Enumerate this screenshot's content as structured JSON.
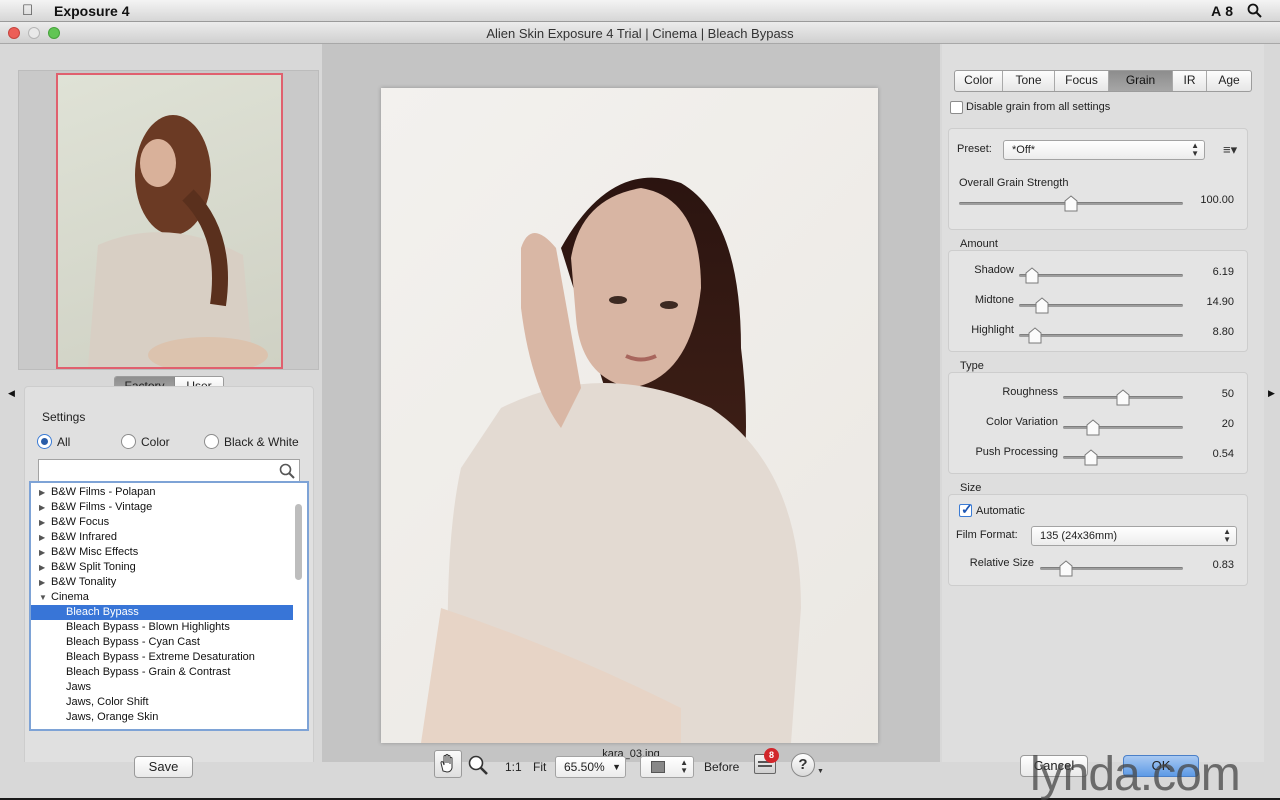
{
  "menubar": {
    "app_name": "Exposure 4",
    "status_num": "8"
  },
  "window": {
    "title": "Alien Skin Exposure 4 Trial | Cinema | Bleach Bypass"
  },
  "left": {
    "factory_tab": "Factory",
    "user_tab": "User",
    "settings_label": "Settings",
    "filters": {
      "all": "All",
      "color": "Color",
      "bw": "Black & White"
    },
    "search_placeholder": "",
    "presets": [
      {
        "label": "B&W Films - Polapan",
        "type": "folder"
      },
      {
        "label": "B&W Films - Vintage",
        "type": "folder"
      },
      {
        "label": "B&W Focus",
        "type": "folder"
      },
      {
        "label": "B&W Infrared",
        "type": "folder"
      },
      {
        "label": "B&W Misc Effects",
        "type": "folder"
      },
      {
        "label": "B&W Split Toning",
        "type": "folder"
      },
      {
        "label": "B&W Tonality",
        "type": "folder"
      },
      {
        "label": "Cinema",
        "type": "open"
      },
      {
        "label": "Bleach Bypass",
        "type": "selected"
      },
      {
        "label": "Bleach Bypass - Blown Highlights",
        "type": "child"
      },
      {
        "label": "Bleach Bypass - Cyan Cast",
        "type": "child"
      },
      {
        "label": "Bleach Bypass - Extreme Desaturation",
        "type": "child"
      },
      {
        "label": "Bleach Bypass - Grain & Contrast",
        "type": "child"
      },
      {
        "label": "Jaws",
        "type": "child"
      },
      {
        "label": "Jaws, Color Shift",
        "type": "child"
      },
      {
        "label": "Jaws, Orange Skin",
        "type": "child"
      }
    ],
    "save_label": "Save"
  },
  "center": {
    "filename": "kara_03.jpg"
  },
  "right": {
    "tabs": [
      "Color",
      "Tone",
      "Focus",
      "Grain",
      "IR",
      "Age"
    ],
    "active_tab": "Grain",
    "disable_label": "Disable grain from all settings",
    "preset_label": "Preset:",
    "preset_value": "*Off*",
    "overall_label": "Overall Grain Strength",
    "overall_value": "100.00",
    "overall_level": 0.5,
    "amount_title": "Amount",
    "amount": [
      {
        "label": "Shadow",
        "value": "6.19",
        "level": 0.08
      },
      {
        "label": "Midtone",
        "value": "14.90",
        "level": 0.14
      },
      {
        "label": "Highlight",
        "value": "8.80",
        "level": 0.1
      }
    ],
    "type_title": "Type",
    "type": [
      {
        "label": "Roughness",
        "value": "50",
        "level": 0.5
      },
      {
        "label": "Color Variation",
        "value": "20",
        "level": 0.25
      },
      {
        "label": "Push Processing",
        "value": "0.54",
        "level": 0.23
      }
    ],
    "size_title": "Size",
    "automatic_label": "Automatic",
    "automatic_checked": true,
    "film_format_label": "Film Format:",
    "film_format_value": "135 (24x36mm)",
    "relative_label": "Relative Size",
    "relative_value": "0.83",
    "relative_level": 0.18
  },
  "bottom": {
    "zoom_1_1": "1:1",
    "fit": "Fit",
    "zoom_value": "65.50%",
    "before": "Before",
    "badge_count": "8",
    "help": "?",
    "cancel": "Cancel",
    "ok": "OK"
  },
  "watermark": "lynda.com"
}
